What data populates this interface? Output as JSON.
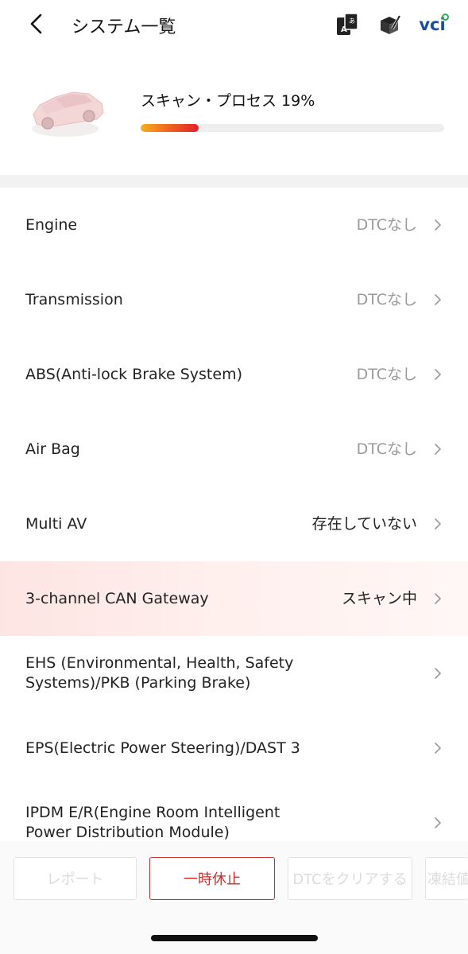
{
  "header": {
    "title": "システム一覧",
    "vci_label": "vci"
  },
  "scan": {
    "label": "スキャン・プロセス 19%",
    "progress_fraction": 0.19
  },
  "systems": [
    {
      "name": "Engine",
      "status": "DTCなし",
      "status_style": "muted"
    },
    {
      "name": "Transmission",
      "status": "DTCなし",
      "status_style": "muted"
    },
    {
      "name": "ABS(Anti-lock Brake System)",
      "status": "DTCなし",
      "status_style": "muted"
    },
    {
      "name": "Air Bag",
      "status": "DTCなし",
      "status_style": "muted"
    },
    {
      "name": "Multi AV",
      "status": "存在していない",
      "status_style": "dark"
    },
    {
      "name": "3-channel CAN Gateway",
      "status": "スキャン中",
      "status_style": "dark",
      "active": true
    },
    {
      "name": "EHS (Environmental, Health, Safety Systems)/PKB (Parking Brake)",
      "status": "",
      "status_style": "muted"
    },
    {
      "name": "EPS(Electric Power Steering)/DAST 3",
      "status": "",
      "status_style": "muted"
    },
    {
      "name": "IPDM E/R(Engine Room Intelligent Power Distribution Module)",
      "status": "",
      "status_style": "muted"
    }
  ],
  "buttons": {
    "report": "レポート",
    "pause": "一時休止",
    "clear_dtc": "DTCをクリアする",
    "freeze": "凍結値"
  },
  "colors": {
    "accent_red": "#c9302c",
    "progress_start": "#f5b022",
    "progress_end": "#e2202a",
    "vci_blue": "#1a4f9e",
    "vci_green": "#2fae5a"
  }
}
